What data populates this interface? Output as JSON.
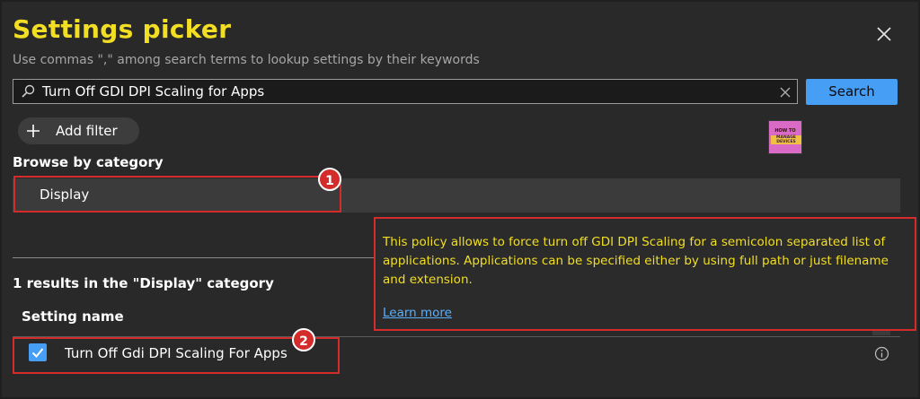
{
  "panel": {
    "title": "Settings picker",
    "subtitle": "Use commas \",\" among search terms to lookup settings by their keywords"
  },
  "search": {
    "value": "Turn Off GDI DPI Scaling for Apps",
    "button_label": "Search"
  },
  "filter": {
    "add_label": "Add filter"
  },
  "logo": {
    "line1": "HOW TO",
    "line2a": "MANAGE",
    "line2b": "DEVICES"
  },
  "browse": {
    "label": "Browse by category",
    "selected_category": "Display"
  },
  "annotations": {
    "badge1": "1",
    "badge2": "2"
  },
  "results": {
    "summary": "1 results in the \"Display\" category",
    "column_header": "Setting name",
    "rows": [
      {
        "name": "Turn Off Gdi DPI Scaling For Apps",
        "checked": true
      }
    ]
  },
  "tooltip": {
    "text": "This policy allows to force turn off GDI DPI Scaling for a semicolon separated list of applications. Applications can be specified either by using full path or just filename and extension.",
    "link": "Learn more"
  },
  "colors": {
    "accent": "#479ef5",
    "title": "#f2df24",
    "highlight": "#d42b2b",
    "background": "#292929"
  }
}
